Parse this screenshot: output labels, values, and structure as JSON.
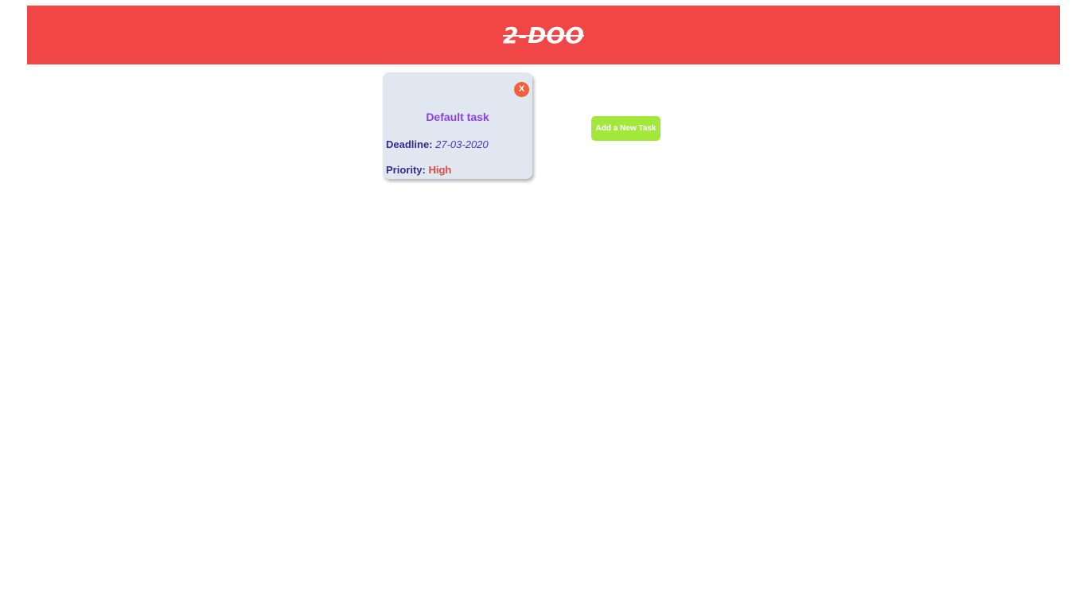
{
  "header": {
    "title": "2-DOO",
    "background_color": "#f14646"
  },
  "tasks": [
    {
      "name": "Default task",
      "close_label": "X",
      "deadline_label": "Deadline:",
      "deadline_value": "27-03-2020",
      "priority_label": "Priority:",
      "priority_value": "High",
      "priority_color": "#e8483c"
    }
  ],
  "actions": {
    "add_task_label": "Add a New Task",
    "add_task_color": "#a2e83a"
  }
}
